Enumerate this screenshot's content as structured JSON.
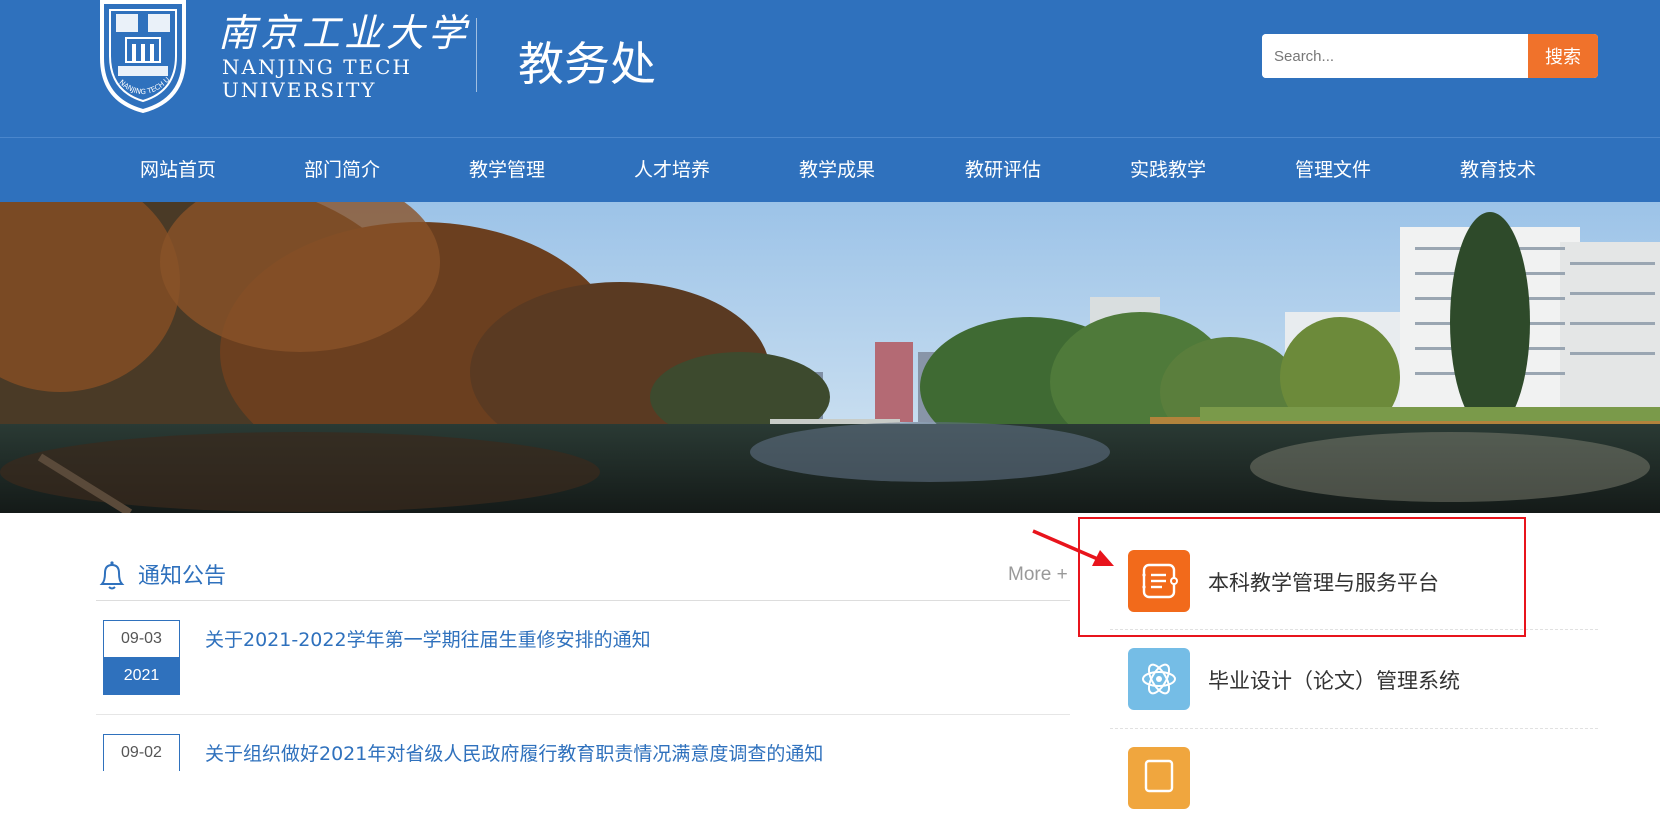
{
  "header": {
    "logo_cn": "南京工业大学",
    "logo_en_line1": "NANJING TECH",
    "logo_en_line2": "UNIVERSITY",
    "seal_text": "NANJING TECH UNIVERSITY",
    "dept_title": "教务处",
    "search": {
      "placeholder": "Search...",
      "button_label": "搜索"
    }
  },
  "nav": {
    "items": [
      {
        "label": "网站首页"
      },
      {
        "label": "部门简介"
      },
      {
        "label": "教学管理"
      },
      {
        "label": "人才培养"
      },
      {
        "label": "教学成果"
      },
      {
        "label": "教研评估"
      },
      {
        "label": "实践教学"
      },
      {
        "label": "管理文件"
      },
      {
        "label": "教育技术"
      }
    ]
  },
  "notices": {
    "title": "通知公告",
    "more_label": "More +",
    "items": [
      {
        "date_md": "09-03",
        "year": "2021",
        "title": "关于2021-2022学年第一学期往届生重修安排的通知"
      },
      {
        "date_md": "09-02",
        "title": "关于组织做好2021年对省级人民政府履行教育职责情况满意度调查的通知"
      }
    ]
  },
  "services": {
    "items": [
      {
        "label": "本科教学管理与服务平台",
        "icon": "list-doc-icon",
        "color": "#f26a1b"
      },
      {
        "label": "毕业设计（论文）管理系统",
        "icon": "atom-icon",
        "color": "#75bde6"
      },
      {
        "label": "",
        "icon": "doc-icon",
        "color": "#f0a63e"
      }
    ]
  },
  "colors": {
    "primary": "#2f71bd",
    "accent": "#f0722b",
    "annotation": "#e8141c"
  }
}
